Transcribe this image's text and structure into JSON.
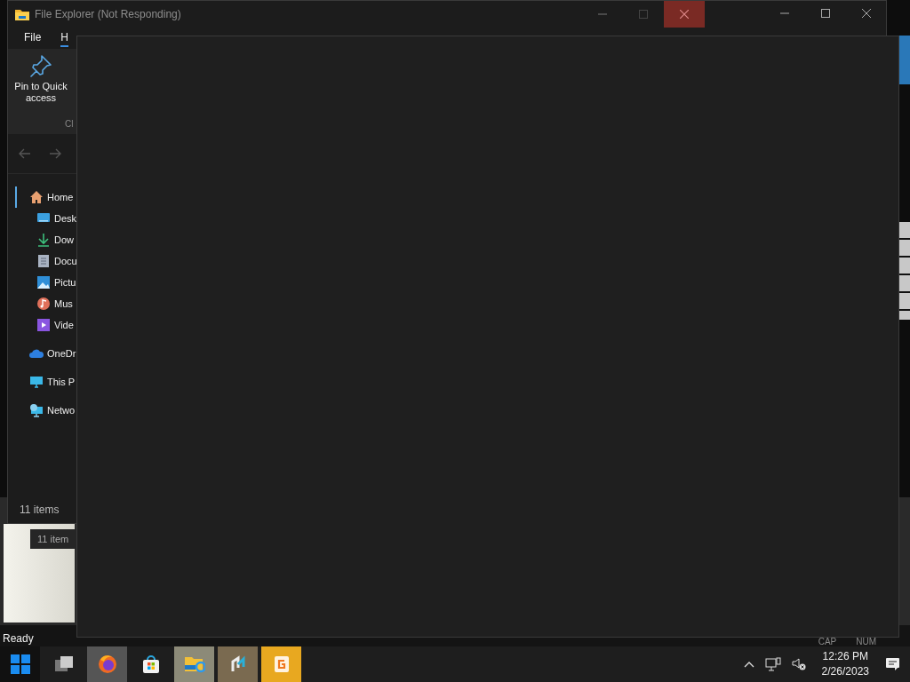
{
  "explorer": {
    "title": "File Explorer (Not Responding)",
    "menu": [
      {
        "label": "File",
        "selected": false
      },
      {
        "label": "H",
        "selected": true
      }
    ],
    "ribbon": {
      "pin_label": "Pin to Quick access",
      "group_label": "Cl"
    },
    "nav": [
      {
        "label": "Home",
        "kind": "home",
        "selected": true,
        "children": [
          {
            "label": "Desk",
            "kind": "desktop",
            "selected": false
          },
          {
            "label": "Dow",
            "kind": "downloads",
            "selected": false
          },
          {
            "label": "Docu",
            "kind": "documents",
            "selected": false
          },
          {
            "label": "Pictu",
            "kind": "pictures",
            "selected": false
          },
          {
            "label": "Mus",
            "kind": "music",
            "selected": false
          },
          {
            "label": "Vide",
            "kind": "videos",
            "selected": false
          }
        ]
      },
      {
        "label": "OneDr",
        "kind": "cloud",
        "selected": false
      },
      {
        "label": "This P",
        "kind": "pc",
        "selected": false
      },
      {
        "label": "Netwo",
        "kind": "network",
        "selected": false
      }
    ],
    "status": "11 items"
  },
  "second_status": "11 item",
  "back_window": {
    "status": "Ready",
    "indicators": [
      "CAP",
      "NUM"
    ]
  },
  "taskbar": {
    "apps": [
      {
        "kind": "start",
        "running": false
      },
      {
        "kind": "taskview",
        "running": false
      },
      {
        "kind": "firefox",
        "running": true
      },
      {
        "kind": "store",
        "running": false
      },
      {
        "kind": "explorer",
        "running": true
      },
      {
        "kind": "sync",
        "running": true
      },
      {
        "kind": "slides",
        "running": true
      }
    ],
    "time": "12:26 PM",
    "date": "2/26/2023"
  }
}
